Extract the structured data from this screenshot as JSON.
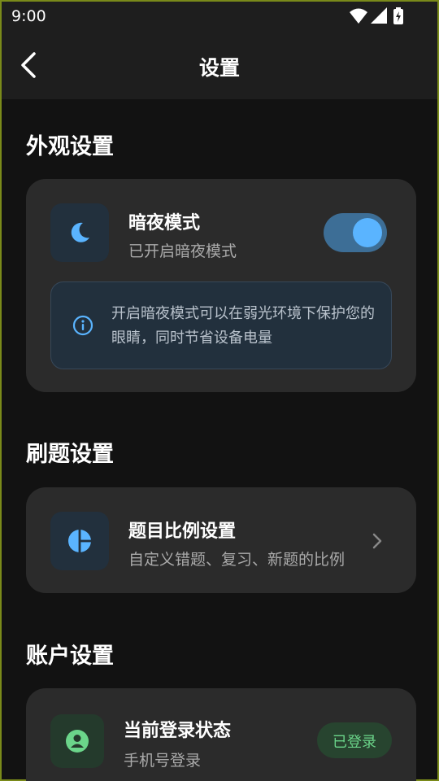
{
  "status_bar": {
    "time": "9:00"
  },
  "header": {
    "title": "设置"
  },
  "sections": {
    "appearance": {
      "title": "外观设置",
      "dark_mode": {
        "title": "暗夜模式",
        "subtitle": "已开启暗夜模式",
        "enabled": true,
        "info": "开启暗夜模式可以在弱光环境下保护您的眼睛，同时节省设备电量"
      }
    },
    "practice": {
      "title": "刷题设置",
      "ratio": {
        "title": "题目比例设置",
        "subtitle": "自定义错题、复习、新题的比例"
      }
    },
    "account": {
      "title": "账户设置",
      "login": {
        "title": "当前登录状态",
        "subtitle": "手机号登录",
        "status": "已登录"
      }
    }
  },
  "colors": {
    "accent": "#5ab4ff",
    "success": "#6bd58a",
    "background": "#121212",
    "card": "#2b2b2b"
  }
}
